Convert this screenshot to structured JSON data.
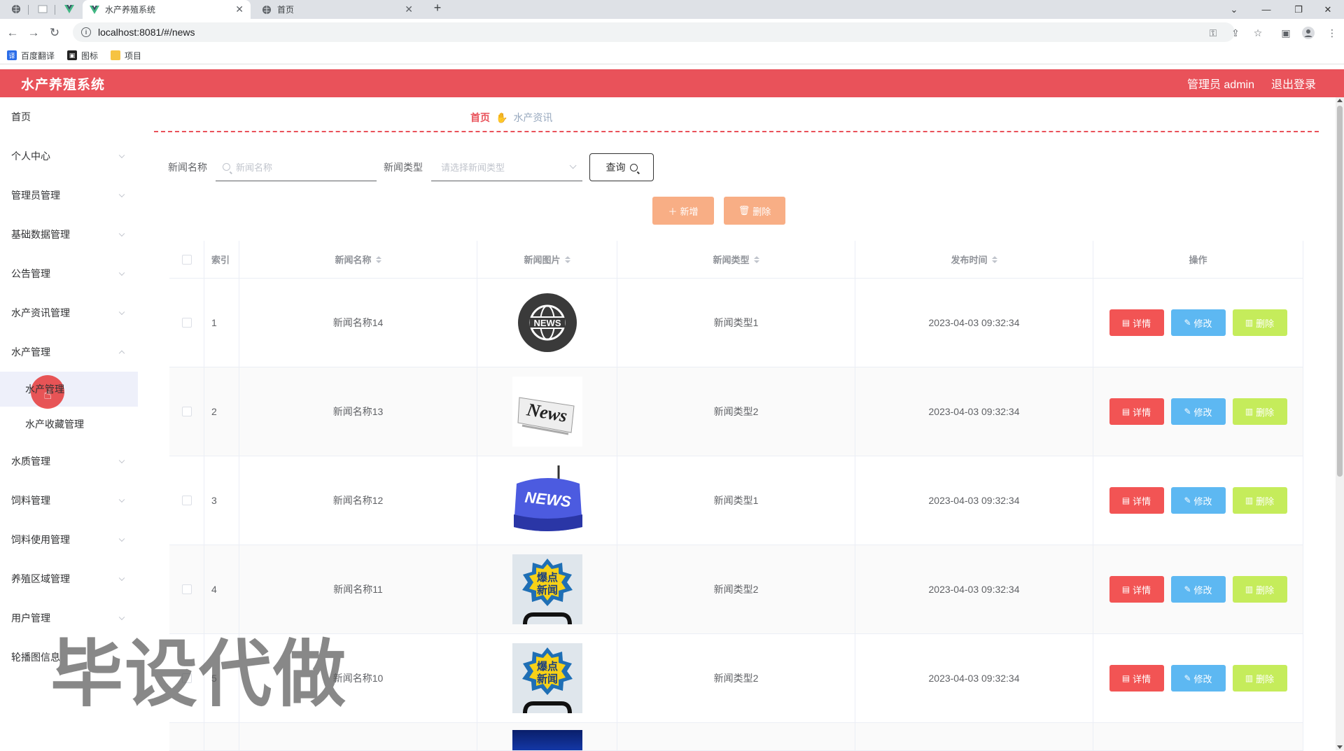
{
  "browser": {
    "tabs": [
      {
        "title": "水产养殖系统",
        "active": true
      },
      {
        "title": "首页",
        "active": false
      }
    ],
    "url": "localhost:8081/#/news",
    "bookmarks": [
      "百度翻译",
      "图标",
      "项目"
    ]
  },
  "header": {
    "title": "水产养殖系统",
    "user": "管理员 admin",
    "logout": "退出登录"
  },
  "sidebar": {
    "items": [
      {
        "label": "首页"
      },
      {
        "label": "个人中心"
      },
      {
        "label": "管理员管理"
      },
      {
        "label": "基础数据管理"
      },
      {
        "label": "公告管理"
      },
      {
        "label": "水产资讯管理"
      },
      {
        "label": "水产管理"
      },
      {
        "label": "水质管理"
      },
      {
        "label": "饲料管理"
      },
      {
        "label": "饲料使用管理"
      },
      {
        "label": "养殖区域管理"
      },
      {
        "label": "用户管理"
      },
      {
        "label": "轮播图信息"
      }
    ],
    "submenu": [
      "水产管理",
      "水产收藏管理"
    ]
  },
  "breadcrumb": {
    "home": "首页",
    "current": "水产资讯"
  },
  "search": {
    "name_label": "新闻名称",
    "name_placeholder": "新闻名称",
    "type_label": "新闻类型",
    "type_placeholder": "请选择新闻类型",
    "query_button": "查询"
  },
  "actions": {
    "add": "新增",
    "delete": "删除"
  },
  "table": {
    "headers": {
      "index": "索引",
      "name": "新闻名称",
      "image": "新闻图片",
      "type": "新闻类型",
      "time": "发布时间",
      "ops": "操作"
    },
    "op_labels": {
      "detail": "详情",
      "edit": "修改",
      "delete": "删除"
    },
    "rows": [
      {
        "index": "1",
        "name": "新闻名称14",
        "image": "globe-news",
        "type": "新闻类型1",
        "time": "2023-04-03 09:32:34"
      },
      {
        "index": "2",
        "name": "新闻名称13",
        "image": "newspaper",
        "type": "新闻类型2",
        "time": "2023-04-03 09:32:34"
      },
      {
        "index": "3",
        "name": "新闻名称12",
        "image": "blue-news-key",
        "type": "新闻类型1",
        "time": "2023-04-03 09:32:34"
      },
      {
        "index": "4",
        "name": "新闻名称11",
        "image": "breaking-news-badge",
        "type": "新闻类型2",
        "time": "2023-04-03 09:32:34"
      },
      {
        "index": "5",
        "name": "新闻名称10",
        "image": "breaking-news-badge",
        "type": "新闻类型2",
        "time": "2023-04-03 09:32:34"
      }
    ],
    "badge_text": {
      "globe": "NEWS",
      "paper": "News",
      "key": "NEWS",
      "burst_line1": "爆点",
      "burst_line2": "新闻"
    }
  },
  "watermark": "毕设代做",
  "colors": {
    "brand": "#e9525a",
    "detail": "#f25454",
    "edit": "#5db8f2",
    "delete": "#c5ec5b",
    "action": "#f8ae85"
  }
}
